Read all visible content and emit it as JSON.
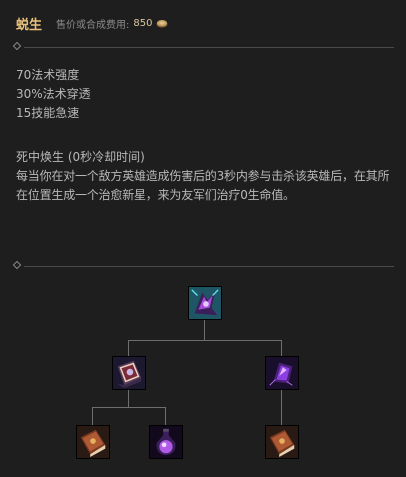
{
  "item": {
    "name": "蜕生",
    "cost_label": "售价或合成费用:",
    "cost_value": "850",
    "gold_icon": "gold-coin-icon"
  },
  "stats": [
    "70法术强度",
    "30%法术穿透",
    "15技能急速"
  ],
  "passive": {
    "title": "死中焕生 (0秒冷却时间)",
    "description": "每当你在对一个敌方英雄造成伤害后的3秒内参与击杀该英雄后，在其所在位置生成一个治愈新星，来为友军们治疗0生命值。"
  },
  "build_tree": {
    "root": {
      "icon": "cosmic-magic-item-icon"
    },
    "children": [
      {
        "icon": "grimoire-book-icon",
        "children": [
          {
            "icon": "amplifying-tome-icon"
          },
          {
            "icon": "purple-potion-icon"
          }
        ]
      },
      {
        "icon": "violet-crystal-icon",
        "children": [
          {
            "icon": "amplifying-tome-icon"
          }
        ]
      }
    ]
  },
  "colors": {
    "background": "#1e1e1e",
    "item_name": "#e8c07a",
    "body_text": "#b8b8b8",
    "muted_text": "#8a8a8a"
  }
}
